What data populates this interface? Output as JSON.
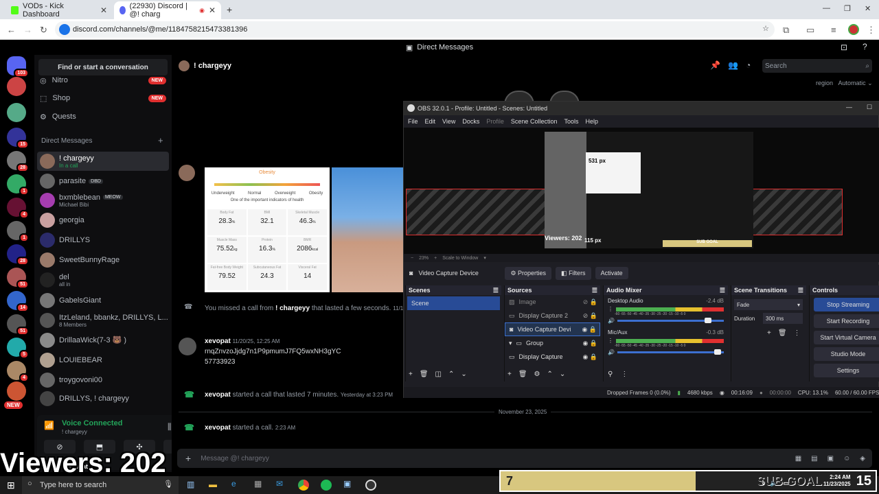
{
  "browser": {
    "tabs": [
      {
        "title": "VODs - Kick Dashboard",
        "active": false
      },
      {
        "title": "(22930) Discord | @! charg",
        "active": true
      }
    ],
    "url": "discord.com/channels/@me/1184758215473381396"
  },
  "discord": {
    "title": "Direct Messages",
    "find_placeholder": "Find or start a conversation",
    "nav": [
      {
        "label": "Nitro",
        "badge": "NEW"
      },
      {
        "label": "Shop",
        "badge": "NEW"
      },
      {
        "label": "Quests",
        "badge": ""
      }
    ],
    "dm_header": "Direct Messages",
    "dms": [
      {
        "name": "! chargeyy",
        "sub": "In a call",
        "color": "#8a6a5a"
      },
      {
        "name": "parasite",
        "sub": "",
        "tag": "DBD",
        "color": "#666"
      },
      {
        "name": "bxmblebean",
        "sub": "Michael Bibi",
        "tag": "MEOW",
        "color": "#a63db0"
      },
      {
        "name": "georgia",
        "sub": "",
        "color": "#c9a0a0"
      },
      {
        "name": "DRILLYS",
        "sub": "",
        "color": "#2b2b6b"
      },
      {
        "name": "SweetBunnyRage",
        "sub": "",
        "color": "#9a7a6a"
      },
      {
        "name": "del",
        "sub": "all in",
        "color": "#222"
      },
      {
        "name": "GabelsGiant",
        "sub": "",
        "color": "#777"
      },
      {
        "name": "ItzLeland, bbankz, DRILLYS, L...",
        "sub": "8 Members",
        "color": "#555"
      },
      {
        "name": "DrillaaWick(7-3 🐻 )",
        "sub": "",
        "color": "#8a8a8a"
      },
      {
        "name": "LOUIEBEAR",
        "sub": "",
        "color": "#b0a090"
      },
      {
        "name": "troygovoni00",
        "sub": "",
        "color": "#666"
      },
      {
        "name": "DRILLYS, ! chargeyy",
        "sub": "",
        "color": "#444"
      }
    ],
    "guild_badges": [
      "103",
      "15",
      "28",
      "1",
      "4",
      "1",
      "28",
      "51",
      "14",
      "51",
      "5",
      "4"
    ],
    "guild_new": "NEW",
    "voice": {
      "status": "Voice Connected",
      "channel": "! chargeyy"
    },
    "user": "xevopat",
    "chat": {
      "recipient": "! chargeyy",
      "search_placeholder": "Search",
      "region_label": "region",
      "region_value": "Automatic",
      "card": {
        "category": "Obesity",
        "scale": [
          "Underweight",
          "Normal",
          "Overweight",
          "Obesity"
        ],
        "caption": "One of the important indicators of health",
        "metrics": [
          {
            "label": "Body Fat",
            "value": "28.3",
            "unit": "%"
          },
          {
            "label": "BMI",
            "value": "32.1",
            "unit": ""
          },
          {
            "label": "Skeletal Muscle",
            "value": "46.3",
            "unit": "%"
          },
          {
            "label": "Muscle Mass",
            "value": "75.52",
            "unit": "kg"
          },
          {
            "label": "Protein",
            "value": "16.3",
            "unit": "%"
          },
          {
            "label": "BMR",
            "value": "2086",
            "unit": "kcal"
          },
          {
            "label": "Fat-free Body Weight",
            "value": "79.52",
            "unit": ""
          },
          {
            "label": "Subcutaneous Fat",
            "value": "24.3",
            "unit": ""
          },
          {
            "label": "Visceral Fat",
            "value": "14",
            "unit": ""
          }
        ]
      },
      "missed": {
        "prefix": "You missed a call from",
        "user": "! chargeyy",
        "suffix": "that lasted a few seconds.",
        "ts": "11/19"
      },
      "msg1": {
        "user": "xevopat",
        "ts": "11/20/25, 12:25 AM",
        "line1": "rnqZnvzoJjdg7n1P9pmumJ7FQ5wxNH3gYC",
        "line2": "57733923"
      },
      "call1": {
        "user": "xevopat",
        "text": "started a call that lasted 7 minutes.",
        "ts": "Yesterday at 3:23 PM"
      },
      "date_divider": "November 23, 2025",
      "call2": {
        "user": "xevopat",
        "text": "started a call.",
        "ts": "2:23 AM"
      },
      "input_placeholder": "Message @! chargeyy"
    }
  },
  "obs": {
    "title": "OBS 32.0.1 - Profile: Untitled - Scenes: Untitled",
    "menu": [
      "File",
      "Edit",
      "View",
      "Docks",
      "Profile",
      "Scene Collection",
      "Tools",
      "Help"
    ],
    "preview_labels": {
      "top": "531 px",
      "bottom": "115 px",
      "viewers": "Viewers: 202",
      "subgoal": "SUB GOAL"
    },
    "zoom": "23%",
    "scale_mode": "Scale to Window",
    "selected_source": "Video Capture Device",
    "prop_buttons": [
      "Properties",
      "Filters",
      "Activate"
    ],
    "scenes_title": "Scenes",
    "scenes": [
      "Scene"
    ],
    "sources_title": "Sources",
    "sources": [
      "Image",
      "Display Capture 2",
      "Video Capture Devi",
      "Group",
      "Display Capture"
    ],
    "mixer_title": "Audio Mixer",
    "mixer": [
      {
        "name": "Desktop Audio",
        "db": "-2.4 dB"
      },
      {
        "name": "Mic/Aux",
        "db": "-0.3 dB"
      }
    ],
    "meter_scale": "-60 -55 -50 -45 -40 -35 -30 -25 -20 -15 -10 -5 0",
    "transitions_title": "Scene Transitions",
    "transition": "Fade",
    "duration_label": "Duration",
    "duration": "300 ms",
    "controls_title": "Controls",
    "controls": [
      "Stop Streaming",
      "Start Recording",
      "Start Virtual Camera",
      "Studio Mode",
      "Settings"
    ],
    "status": {
      "dropped": "Dropped Frames 0 (0.0%)",
      "kbps": "4680 kbps",
      "stream_time": "00:16:09",
      "rec_time": "00:00:00",
      "cpu": "CPU: 13.1%",
      "fps": "60.00 / 60.00 FPS"
    }
  },
  "overlay": {
    "viewers": "Viewers: 202",
    "subgoal_count": "7",
    "subgoal_label": "SUB GOAL",
    "subgoal_target": "15"
  },
  "taskbar": {
    "search_placeholder": "Type here to search",
    "time": "2:24 AM",
    "date": "11/23/2025"
  }
}
